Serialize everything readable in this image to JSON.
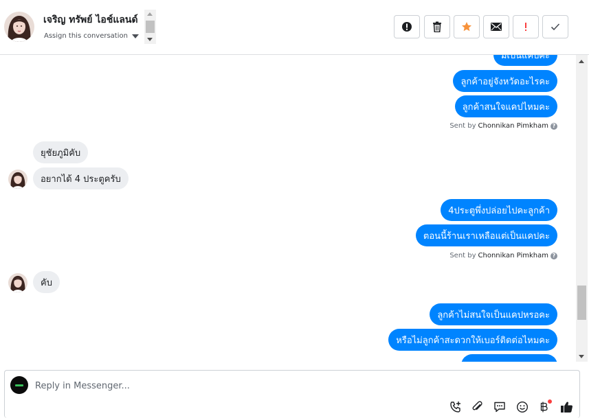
{
  "header": {
    "contact_name": "เจริญ ทรัพย์ ไอช์แลนด์",
    "assign_label": "Assign this conversation",
    "actions": [
      {
        "name": "alert-circle",
        "icon": "exclamation-circle-icon"
      },
      {
        "name": "delete",
        "icon": "trash-icon"
      },
      {
        "name": "star",
        "icon": "star-icon",
        "color": "#f7923b"
      },
      {
        "name": "email",
        "icon": "envelope-icon"
      },
      {
        "name": "important",
        "icon": "exclamation-icon",
        "color": "#fa3e3e"
      },
      {
        "name": "done",
        "icon": "checkmark-icon"
      }
    ]
  },
  "messages": [
    {
      "dir": "out",
      "text": "มีเป็นแคปคะ"
    },
    {
      "dir": "out",
      "text": "ลูกค้าอยู่จังหวัดอะไรคะ"
    },
    {
      "dir": "out",
      "text": "ลูกค้าสนใจแคปไหมคะ"
    },
    {
      "type": "sent_by",
      "prefix": "Sent by",
      "name": "Chonnikan Pimkham"
    },
    {
      "dir": "in",
      "text": "ยุชัยภูมิคับ"
    },
    {
      "dir": "in",
      "text": "อยากได้ 4 ประตูครับ"
    },
    {
      "dir": "out",
      "text": "4ประตูพึ่งปล่อยไปคะลูกค้า"
    },
    {
      "dir": "out",
      "text": "ตอนนี้ร้านเราเหลือแต่เป็นแคปคะ"
    },
    {
      "type": "sent_by",
      "prefix": "Sent by",
      "name": "Chonnikan Pimkham"
    },
    {
      "dir": "in",
      "text": "คับ"
    },
    {
      "dir": "out",
      "text": "ลูกค้าไม่สนใจเป็นแคปหรอคะ"
    },
    {
      "dir": "out",
      "text": "หรือไม่ลูกค้าสะดวกให้เบอร์ติดต่อไหมคะ"
    }
  ],
  "composer": {
    "placeholder": "Reply in Messenger...",
    "tools": [
      "phone-plus-icon",
      "paperclip-icon",
      "chat-bubble-icon",
      "smiley-icon",
      "baht-icon",
      "thumbs-up-icon"
    ]
  },
  "colors": {
    "outgoing_bubble": "#0084ff",
    "incoming_bubble": "#eceef1",
    "notification_dot": "#fa3e3e"
  }
}
